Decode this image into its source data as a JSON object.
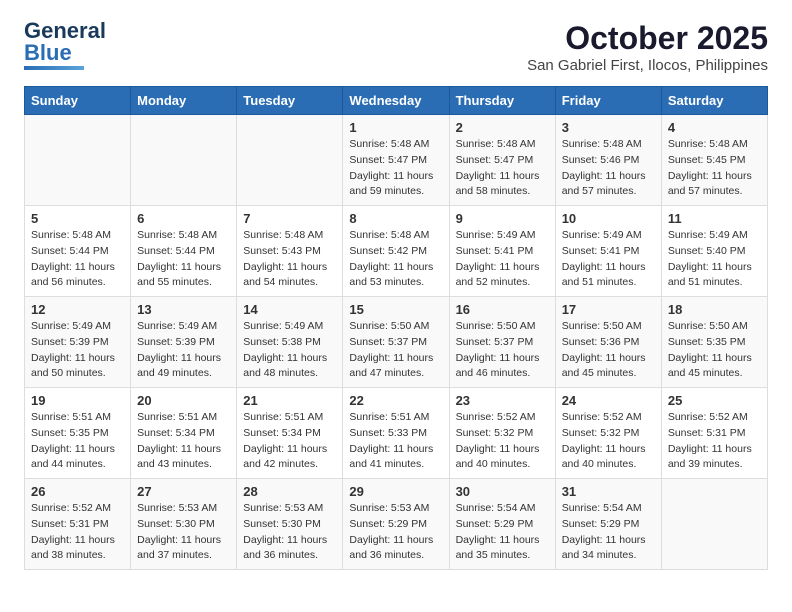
{
  "logo": {
    "part1": "General",
    "part2": "Blue"
  },
  "title": "October 2025",
  "location": "San Gabriel First, Ilocos, Philippines",
  "weekdays": [
    "Sunday",
    "Monday",
    "Tuesday",
    "Wednesday",
    "Thursday",
    "Friday",
    "Saturday"
  ],
  "weeks": [
    [
      {
        "day": "",
        "sunrise": "",
        "sunset": "",
        "daylight": ""
      },
      {
        "day": "",
        "sunrise": "",
        "sunset": "",
        "daylight": ""
      },
      {
        "day": "",
        "sunrise": "",
        "sunset": "",
        "daylight": ""
      },
      {
        "day": "1",
        "sunrise": "Sunrise: 5:48 AM",
        "sunset": "Sunset: 5:47 PM",
        "daylight": "Daylight: 11 hours and 59 minutes."
      },
      {
        "day": "2",
        "sunrise": "Sunrise: 5:48 AM",
        "sunset": "Sunset: 5:47 PM",
        "daylight": "Daylight: 11 hours and 58 minutes."
      },
      {
        "day": "3",
        "sunrise": "Sunrise: 5:48 AM",
        "sunset": "Sunset: 5:46 PM",
        "daylight": "Daylight: 11 hours and 57 minutes."
      },
      {
        "day": "4",
        "sunrise": "Sunrise: 5:48 AM",
        "sunset": "Sunset: 5:45 PM",
        "daylight": "Daylight: 11 hours and 57 minutes."
      }
    ],
    [
      {
        "day": "5",
        "sunrise": "Sunrise: 5:48 AM",
        "sunset": "Sunset: 5:44 PM",
        "daylight": "Daylight: 11 hours and 56 minutes."
      },
      {
        "day": "6",
        "sunrise": "Sunrise: 5:48 AM",
        "sunset": "Sunset: 5:44 PM",
        "daylight": "Daylight: 11 hours and 55 minutes."
      },
      {
        "day": "7",
        "sunrise": "Sunrise: 5:48 AM",
        "sunset": "Sunset: 5:43 PM",
        "daylight": "Daylight: 11 hours and 54 minutes."
      },
      {
        "day": "8",
        "sunrise": "Sunrise: 5:48 AM",
        "sunset": "Sunset: 5:42 PM",
        "daylight": "Daylight: 11 hours and 53 minutes."
      },
      {
        "day": "9",
        "sunrise": "Sunrise: 5:49 AM",
        "sunset": "Sunset: 5:41 PM",
        "daylight": "Daylight: 11 hours and 52 minutes."
      },
      {
        "day": "10",
        "sunrise": "Sunrise: 5:49 AM",
        "sunset": "Sunset: 5:41 PM",
        "daylight": "Daylight: 11 hours and 51 minutes."
      },
      {
        "day": "11",
        "sunrise": "Sunrise: 5:49 AM",
        "sunset": "Sunset: 5:40 PM",
        "daylight": "Daylight: 11 hours and 51 minutes."
      }
    ],
    [
      {
        "day": "12",
        "sunrise": "Sunrise: 5:49 AM",
        "sunset": "Sunset: 5:39 PM",
        "daylight": "Daylight: 11 hours and 50 minutes."
      },
      {
        "day": "13",
        "sunrise": "Sunrise: 5:49 AM",
        "sunset": "Sunset: 5:39 PM",
        "daylight": "Daylight: 11 hours and 49 minutes."
      },
      {
        "day": "14",
        "sunrise": "Sunrise: 5:49 AM",
        "sunset": "Sunset: 5:38 PM",
        "daylight": "Daylight: 11 hours and 48 minutes."
      },
      {
        "day": "15",
        "sunrise": "Sunrise: 5:50 AM",
        "sunset": "Sunset: 5:37 PM",
        "daylight": "Daylight: 11 hours and 47 minutes."
      },
      {
        "day": "16",
        "sunrise": "Sunrise: 5:50 AM",
        "sunset": "Sunset: 5:37 PM",
        "daylight": "Daylight: 11 hours and 46 minutes."
      },
      {
        "day": "17",
        "sunrise": "Sunrise: 5:50 AM",
        "sunset": "Sunset: 5:36 PM",
        "daylight": "Daylight: 11 hours and 45 minutes."
      },
      {
        "day": "18",
        "sunrise": "Sunrise: 5:50 AM",
        "sunset": "Sunset: 5:35 PM",
        "daylight": "Daylight: 11 hours and 45 minutes."
      }
    ],
    [
      {
        "day": "19",
        "sunrise": "Sunrise: 5:51 AM",
        "sunset": "Sunset: 5:35 PM",
        "daylight": "Daylight: 11 hours and 44 minutes."
      },
      {
        "day": "20",
        "sunrise": "Sunrise: 5:51 AM",
        "sunset": "Sunset: 5:34 PM",
        "daylight": "Daylight: 11 hours and 43 minutes."
      },
      {
        "day": "21",
        "sunrise": "Sunrise: 5:51 AM",
        "sunset": "Sunset: 5:34 PM",
        "daylight": "Daylight: 11 hours and 42 minutes."
      },
      {
        "day": "22",
        "sunrise": "Sunrise: 5:51 AM",
        "sunset": "Sunset: 5:33 PM",
        "daylight": "Daylight: 11 hours and 41 minutes."
      },
      {
        "day": "23",
        "sunrise": "Sunrise: 5:52 AM",
        "sunset": "Sunset: 5:32 PM",
        "daylight": "Daylight: 11 hours and 40 minutes."
      },
      {
        "day": "24",
        "sunrise": "Sunrise: 5:52 AM",
        "sunset": "Sunset: 5:32 PM",
        "daylight": "Daylight: 11 hours and 40 minutes."
      },
      {
        "day": "25",
        "sunrise": "Sunrise: 5:52 AM",
        "sunset": "Sunset: 5:31 PM",
        "daylight": "Daylight: 11 hours and 39 minutes."
      }
    ],
    [
      {
        "day": "26",
        "sunrise": "Sunrise: 5:52 AM",
        "sunset": "Sunset: 5:31 PM",
        "daylight": "Daylight: 11 hours and 38 minutes."
      },
      {
        "day": "27",
        "sunrise": "Sunrise: 5:53 AM",
        "sunset": "Sunset: 5:30 PM",
        "daylight": "Daylight: 11 hours and 37 minutes."
      },
      {
        "day": "28",
        "sunrise": "Sunrise: 5:53 AM",
        "sunset": "Sunset: 5:30 PM",
        "daylight": "Daylight: 11 hours and 36 minutes."
      },
      {
        "day": "29",
        "sunrise": "Sunrise: 5:53 AM",
        "sunset": "Sunset: 5:29 PM",
        "daylight": "Daylight: 11 hours and 36 minutes."
      },
      {
        "day": "30",
        "sunrise": "Sunrise: 5:54 AM",
        "sunset": "Sunset: 5:29 PM",
        "daylight": "Daylight: 11 hours and 35 minutes."
      },
      {
        "day": "31",
        "sunrise": "Sunrise: 5:54 AM",
        "sunset": "Sunset: 5:29 PM",
        "daylight": "Daylight: 11 hours and 34 minutes."
      },
      {
        "day": "",
        "sunrise": "",
        "sunset": "",
        "daylight": ""
      }
    ]
  ]
}
